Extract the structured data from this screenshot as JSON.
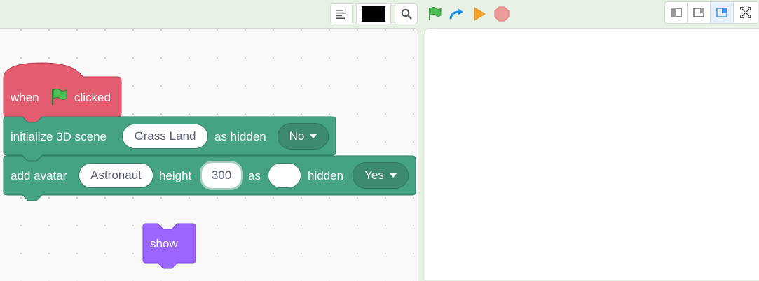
{
  "toolbar": {
    "color_swatch": "#000000",
    "icons": [
      "align-left-icon",
      "search-icon",
      "green-flag-icon",
      "redo-arrow-icon",
      "play-triangle-icon",
      "stop-icon",
      "small-stage-icon",
      "large-stage-icon",
      "layout-icon",
      "fullscreen-icon"
    ]
  },
  "colors": {
    "event_block": "#e35c6f",
    "scene_block": "#45a283",
    "looks_block": "#9a66ff",
    "flag": "#45b54a"
  },
  "blocks": {
    "when_flag": {
      "label_when": "when",
      "label_clicked": "clicked"
    },
    "init_scene": {
      "label": "initialize 3D scene",
      "scene_value": "Grass Land",
      "label_hidden": "as hidden",
      "hidden_value": "No"
    },
    "add_avatar": {
      "label": "add avatar",
      "avatar_value": "Astronaut",
      "label_height": "height",
      "height_value": "300",
      "label_as": "as",
      "as_value": "",
      "label_hidden": "hidden",
      "hidden_value": "Yes"
    },
    "show": {
      "label": "show"
    }
  }
}
